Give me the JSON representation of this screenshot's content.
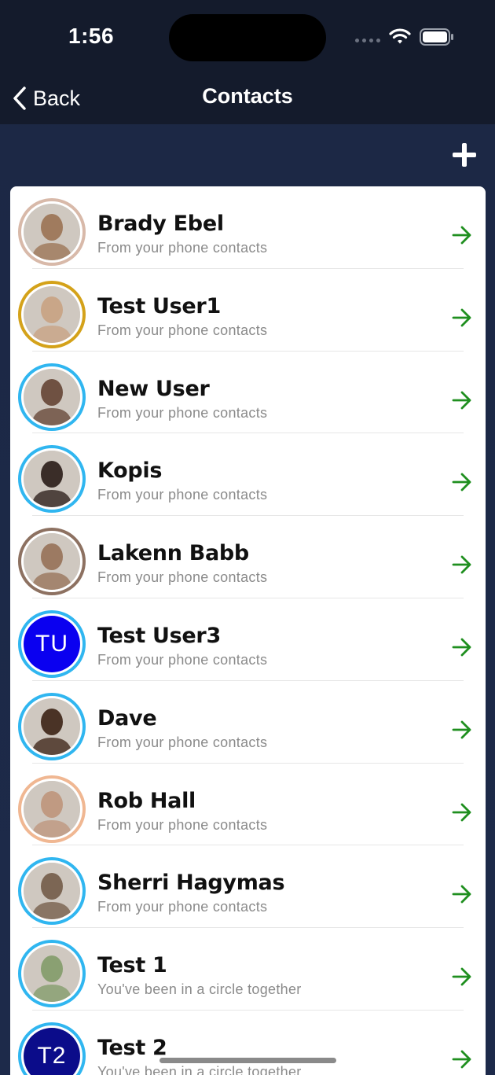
{
  "status_bar": {
    "time": "1:56",
    "icons": [
      "signal-icon",
      "wifi-icon",
      "battery-icon"
    ]
  },
  "nav": {
    "back_label": "Back",
    "title": "Contacts",
    "add_icon": "plus-icon"
  },
  "colors": {
    "background": "#1d2a4a",
    "arrow": "#1f8f1f",
    "initials_bg": "#0a00f0",
    "initials_bg_dark": "#0b0c8a"
  },
  "contacts": [
    {
      "name": "Brady Ebel",
      "subtitle": "From your phone contacts",
      "ring": "#d8b9a9",
      "avatar": "photo",
      "tone": "#a07b5e"
    },
    {
      "name": "Test User1",
      "subtitle": "From your phone contacts",
      "ring": "#d4a21a",
      "avatar": "photo",
      "tone": "#c9a688"
    },
    {
      "name": "New User",
      "subtitle": "From your phone contacts",
      "ring": "#30b6f0",
      "avatar": "photo",
      "tone": "#6f5142"
    },
    {
      "name": "Kopis",
      "subtitle": "From your phone contacts",
      "ring": "#30b6f0",
      "avatar": "photo",
      "tone": "#3a2d28"
    },
    {
      "name": "Lakenn Babb",
      "subtitle": "From your phone contacts",
      "ring": "#8d7161",
      "avatar": "photo",
      "tone": "#9c7a62"
    },
    {
      "name": "Test User3",
      "subtitle": "From your phone contacts",
      "ring": "#30b6f0",
      "avatar": "initials",
      "initials": "TU",
      "tone": "#0a00f0"
    },
    {
      "name": "Dave",
      "subtitle": "From your phone contacts",
      "ring": "#30b6f0",
      "avatar": "photo",
      "tone": "#4a3326"
    },
    {
      "name": "Rob Hall",
      "subtitle": "From your phone contacts",
      "ring": "#f0b792",
      "avatar": "photo",
      "tone": "#c09a82"
    },
    {
      "name": "Sherri Hagymas",
      "subtitle": "From your phone contacts",
      "ring": "#30b6f0",
      "avatar": "photo",
      "tone": "#7c6654"
    },
    {
      "name": "Test 1",
      "subtitle": "You've been in a circle together",
      "ring": "#30b6f0",
      "avatar": "photo",
      "tone": "#8aa072"
    },
    {
      "name": "Test 2",
      "subtitle": "You've been in a circle together",
      "ring": "#30b6f0",
      "avatar": "initials",
      "initials": "T2",
      "tone": "#0b0c8a"
    }
  ]
}
